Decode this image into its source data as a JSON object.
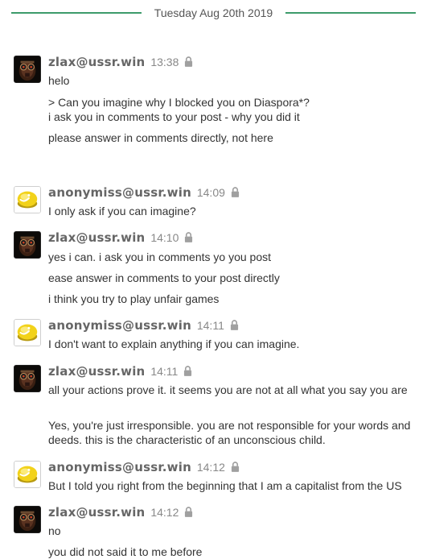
{
  "day_divider": {
    "label": "Tuesday Aug 20th 2019"
  },
  "messages": [
    {
      "sender": "zlax@ussr.win",
      "time": "13:38",
      "avatar": "zlax-avatar",
      "lines": [
        "helo",
        ">  Can you imagine why I blocked you on Diaspora*?\ni ask you in comments to your post - why you did it",
        "please answer in comments directly, not here"
      ]
    },
    {
      "sender": "anonymiss@ussr.win",
      "time": "14:09",
      "avatar": "anonymiss-avatar",
      "lines": [
        "I only ask if you can imagine?"
      ]
    },
    {
      "sender": "zlax@ussr.win",
      "time": "14:10",
      "avatar": "zlax-avatar",
      "lines": [
        "yes i can. i ask you in comments yo you post",
        "ease answer in comments to your post directly",
        "i think you try to play unfair games"
      ]
    },
    {
      "sender": "anonymiss@ussr.win",
      "time": "14:11",
      "avatar": "anonymiss-avatar",
      "lines": [
        "I don't want to explain anything if you can imagine."
      ]
    },
    {
      "sender": "zlax@ussr.win",
      "time": "14:11",
      "avatar": "zlax-avatar",
      "lines": [
        "all your actions prove it. it seems you are not at all what you say you are",
        "Yes, you're just irresponsible. you are not responsible for your words and deeds. this is the characteristic of an unconscious child."
      ]
    },
    {
      "sender": "anonymiss@ussr.win",
      "time": "14:12",
      "avatar": "anonymiss-avatar",
      "lines": [
        "But I told you right from the beginning that I am a capitalist from the US"
      ]
    },
    {
      "sender": "zlax@ussr.win",
      "time": "14:12",
      "avatar": "zlax-avatar",
      "lines": [
        "no",
        "you did not said it to me before"
      ]
    }
  ]
}
